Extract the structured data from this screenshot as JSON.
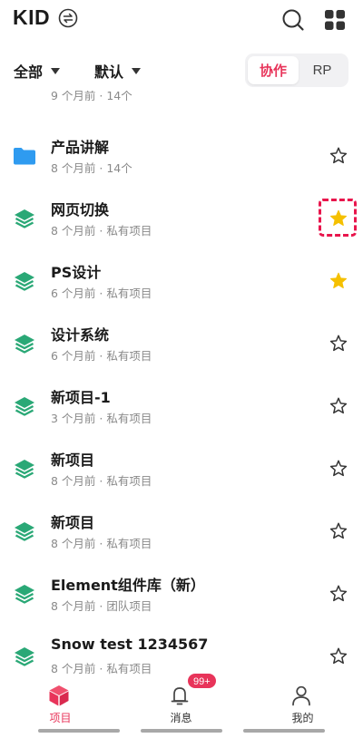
{
  "header": {
    "app_name": "KID"
  },
  "filters": {
    "scope_label": "全部",
    "sort_label": "默认",
    "segments": [
      "协作",
      "RP"
    ],
    "active_segment": "协作"
  },
  "partial_row_meta": "9 个月前 · 14个",
  "items": [
    {
      "name": "产品讲解",
      "meta": "8 个月前 · 14个",
      "type": "folder",
      "starred": false
    },
    {
      "name": "网页切换",
      "meta": "8 个月前 · 私有项目",
      "type": "project",
      "starred": true,
      "highlighted": true
    },
    {
      "name": "PS设计",
      "meta": "6 个月前 · 私有项目",
      "type": "project",
      "starred": true
    },
    {
      "name": "设计系统",
      "meta": "6 个月前 · 私有项目",
      "type": "project",
      "starred": false
    },
    {
      "name": "新项目-1",
      "meta": "3 个月前 · 私有项目",
      "type": "project",
      "starred": false
    },
    {
      "name": "新项目",
      "meta": "8 个月前 · 私有项目",
      "type": "project",
      "starred": false
    },
    {
      "name": "新项目",
      "meta": "8 个月前 · 私有项目",
      "type": "project",
      "starred": false
    },
    {
      "name": "Element组件库（新）",
      "meta": "8 个月前 · 团队项目",
      "type": "project",
      "starred": false
    },
    {
      "name": "Snow test 1234567",
      "meta": "8 个月前 · 私有项目",
      "type": "project",
      "starred": false
    }
  ],
  "bottom_nav": {
    "tabs": [
      {
        "label": "项目",
        "icon": "cube-icon",
        "active": true
      },
      {
        "label": "消息",
        "icon": "bell-icon",
        "badge": "99+"
      },
      {
        "label": "我的",
        "icon": "person-icon"
      }
    ]
  },
  "colors": {
    "accent": "#e8345a",
    "folder": "#2f9bf0",
    "project": "#2aa876",
    "star_filled": "#f5c000",
    "highlight_border": "#e8154c"
  }
}
